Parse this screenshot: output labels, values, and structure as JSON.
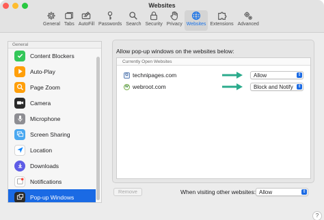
{
  "window": {
    "title": "Websites"
  },
  "toolbar": {
    "items": [
      {
        "label": "General",
        "icon": "gear-icon"
      },
      {
        "label": "Tabs",
        "icon": "tabs-icon"
      },
      {
        "label": "AutoFill",
        "icon": "autofill-icon"
      },
      {
        "label": "Passwords",
        "icon": "key-icon"
      },
      {
        "label": "Search",
        "icon": "search-icon"
      },
      {
        "label": "Security",
        "icon": "lock-icon"
      },
      {
        "label": "Privacy",
        "icon": "hand-icon"
      },
      {
        "label": "Websites",
        "icon": "globe-icon",
        "active": true
      },
      {
        "label": "Extensions",
        "icon": "extensions-icon"
      },
      {
        "label": "Advanced",
        "icon": "gears-icon"
      }
    ]
  },
  "sidebar": {
    "section": "General",
    "items": [
      {
        "label": "Content Blockers",
        "icon": "content-blockers-icon",
        "color": "#34c759"
      },
      {
        "label": "Auto-Play",
        "icon": "play-icon",
        "color": "#ff9f0a"
      },
      {
        "label": "Page Zoom",
        "icon": "zoom-icon",
        "color": "#ff9f0a"
      },
      {
        "label": "Camera",
        "icon": "camera-icon",
        "color": "#2b2b2b"
      },
      {
        "label": "Microphone",
        "icon": "microphone-icon",
        "color": "#8e8e93"
      },
      {
        "label": "Screen Sharing",
        "icon": "screen-sharing-icon",
        "color": "#4aa8f0"
      },
      {
        "label": "Location",
        "icon": "location-icon",
        "color": "#0a84ff"
      },
      {
        "label": "Downloads",
        "icon": "downloads-icon",
        "color": "#5e5ce6"
      },
      {
        "label": "Notifications",
        "icon": "notifications-icon",
        "color": "#ff453a"
      },
      {
        "label": "Pop-up Windows",
        "icon": "popup-windows-icon",
        "color": "#2b2b2b",
        "selected": true
      }
    ]
  },
  "main": {
    "heading": "Allow pop-up windows on the websites below:",
    "table_header": "Currently Open Websites",
    "rows": [
      {
        "site": "technipages.com",
        "setting": "Allow",
        "icon": "technipages-favicon"
      },
      {
        "site": "webroot.com",
        "setting": "Block and Notify",
        "icon": "webroot-favicon"
      }
    ],
    "remove_label": "Remove",
    "other_label": "When visiting other websites:",
    "other_value": "Allow",
    "help_label": "?"
  },
  "colors": {
    "accent": "#1a6ae4",
    "arrow": "#2bab8c"
  }
}
